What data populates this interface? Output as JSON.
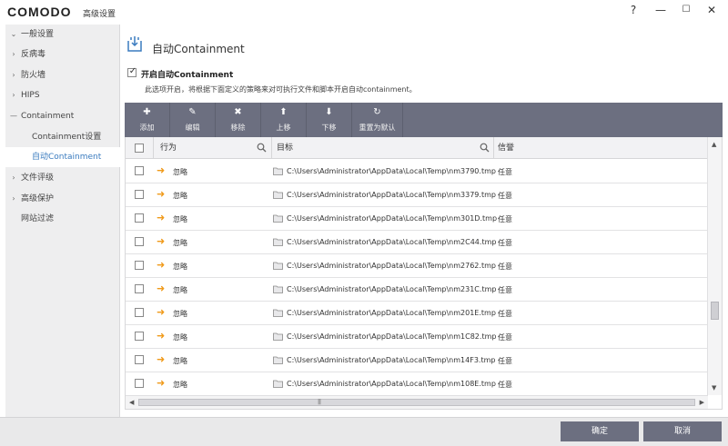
{
  "window": {
    "logo": "COMODO",
    "title": "高级设置",
    "help": "?",
    "minimize": "—",
    "maximize": "☐",
    "close": "✕"
  },
  "sidebar": {
    "items": [
      {
        "label": "一般设置",
        "expander": "⌄"
      },
      {
        "label": "反病毒",
        "expander": "›"
      },
      {
        "label": "防火墙",
        "expander": "›"
      },
      {
        "label": "HIPS",
        "expander": "›"
      },
      {
        "label": "Containment",
        "expander": "—"
      },
      {
        "label": "Containment设置"
      },
      {
        "label": "自动Containment"
      },
      {
        "label": "文件评级",
        "expander": "›"
      },
      {
        "label": "高级保护",
        "expander": "›"
      },
      {
        "label": "网站过滤"
      }
    ]
  },
  "main": {
    "title": "自动Containment",
    "enable_label": "开启自动Containment",
    "enable_checked": true,
    "description": "此选项开启，将根据下面定义的策略来对可执行文件和脚本开启自动containment。"
  },
  "toolbar": {
    "buttons": [
      {
        "label": "添加",
        "icon": "plus-icon",
        "glyph": "✚"
      },
      {
        "label": "编辑",
        "icon": "edit-icon",
        "glyph": "✎"
      },
      {
        "label": "移除",
        "icon": "remove-icon",
        "glyph": "✖"
      },
      {
        "label": "上移",
        "icon": "up-icon",
        "glyph": "⬆"
      },
      {
        "label": "下移",
        "icon": "down-icon",
        "glyph": "⬇"
      },
      {
        "label": "重置为默认",
        "icon": "reset-icon",
        "glyph": "↻"
      }
    ]
  },
  "table": {
    "columns": {
      "action": "行为",
      "target": "目标",
      "reputation": "信誉"
    },
    "rows": [
      {
        "action": "忽略",
        "target": "C:\\Users\\Administrator\\AppData\\Local\\Temp\\nm3790.tmp",
        "reputation": "任意"
      },
      {
        "action": "忽略",
        "target": "C:\\Users\\Administrator\\AppData\\Local\\Temp\\nm3379.tmp",
        "reputation": "任意"
      },
      {
        "action": "忽略",
        "target": "C:\\Users\\Administrator\\AppData\\Local\\Temp\\nm301D.tmp",
        "reputation": "任意"
      },
      {
        "action": "忽略",
        "target": "C:\\Users\\Administrator\\AppData\\Local\\Temp\\nm2C44.tmp",
        "reputation": "任意"
      },
      {
        "action": "忽略",
        "target": "C:\\Users\\Administrator\\AppData\\Local\\Temp\\nm2762.tmp",
        "reputation": "任意"
      },
      {
        "action": "忽略",
        "target": "C:\\Users\\Administrator\\AppData\\Local\\Temp\\nm231C.tmp",
        "reputation": "任意"
      },
      {
        "action": "忽略",
        "target": "C:\\Users\\Administrator\\AppData\\Local\\Temp\\nm201E.tmp",
        "reputation": "任意"
      },
      {
        "action": "忽略",
        "target": "C:\\Users\\Administrator\\AppData\\Local\\Temp\\nm1C82.tmp",
        "reputation": "任意"
      },
      {
        "action": "忽略",
        "target": "C:\\Users\\Administrator\\AppData\\Local\\Temp\\nm14F3.tmp",
        "reputation": "任意"
      },
      {
        "action": "忽略",
        "target": "C:\\Users\\Administrator\\AppData\\Local\\Temp\\nm108E.tmp",
        "reputation": "任意"
      }
    ]
  },
  "footer": {
    "ok": "确定",
    "cancel": "取消"
  },
  "colors": {
    "accent": "#3a7bbf",
    "toolbar": "#6c6f80",
    "action_arrow": "#f09a1a"
  }
}
